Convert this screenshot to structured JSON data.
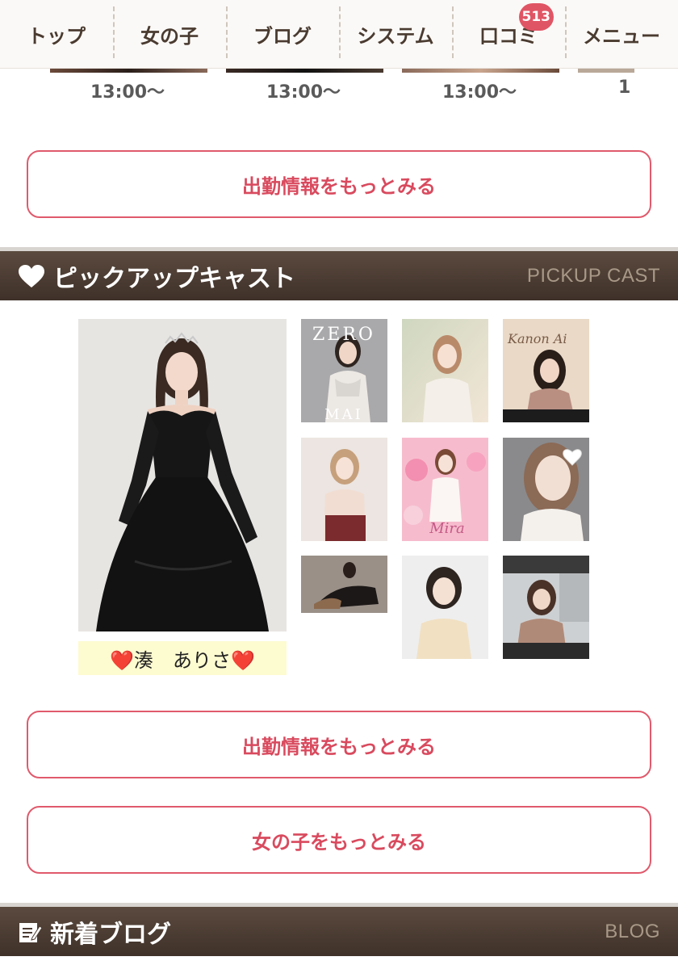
{
  "nav": {
    "items": [
      {
        "label": "トップ"
      },
      {
        "label": "女の子"
      },
      {
        "label": "ブログ"
      },
      {
        "label": "システム"
      },
      {
        "label": "口コミ",
        "badge": "513"
      },
      {
        "label": "メニュー"
      }
    ]
  },
  "schedule": {
    "times": [
      "13:00〜",
      "13:00〜",
      "13:00〜",
      "1"
    ]
  },
  "buttons": {
    "attendance_top": "出勤情報をもっとみる",
    "attendance_bottom": "出勤情報をもっとみる",
    "girls_more": "女の子をもっとみる"
  },
  "pickup": {
    "title": "ピックアップキャスト",
    "subtitle": "PICKUP CAST",
    "featured_name": "❤️湊　ありさ❤️",
    "thumb_text": {
      "zero_top": "ZERO",
      "zero_bottom": "MAI",
      "script_mira": "Mira",
      "script_kanon": "Kanon Ai"
    }
  },
  "blog": {
    "title": "新着ブログ",
    "subtitle": "BLOG"
  },
  "colors": {
    "accent": "#e05a6c",
    "header_bg": "#4b3b31",
    "badge": "#e05565",
    "name_tag_bg": "#fdfbd0"
  }
}
